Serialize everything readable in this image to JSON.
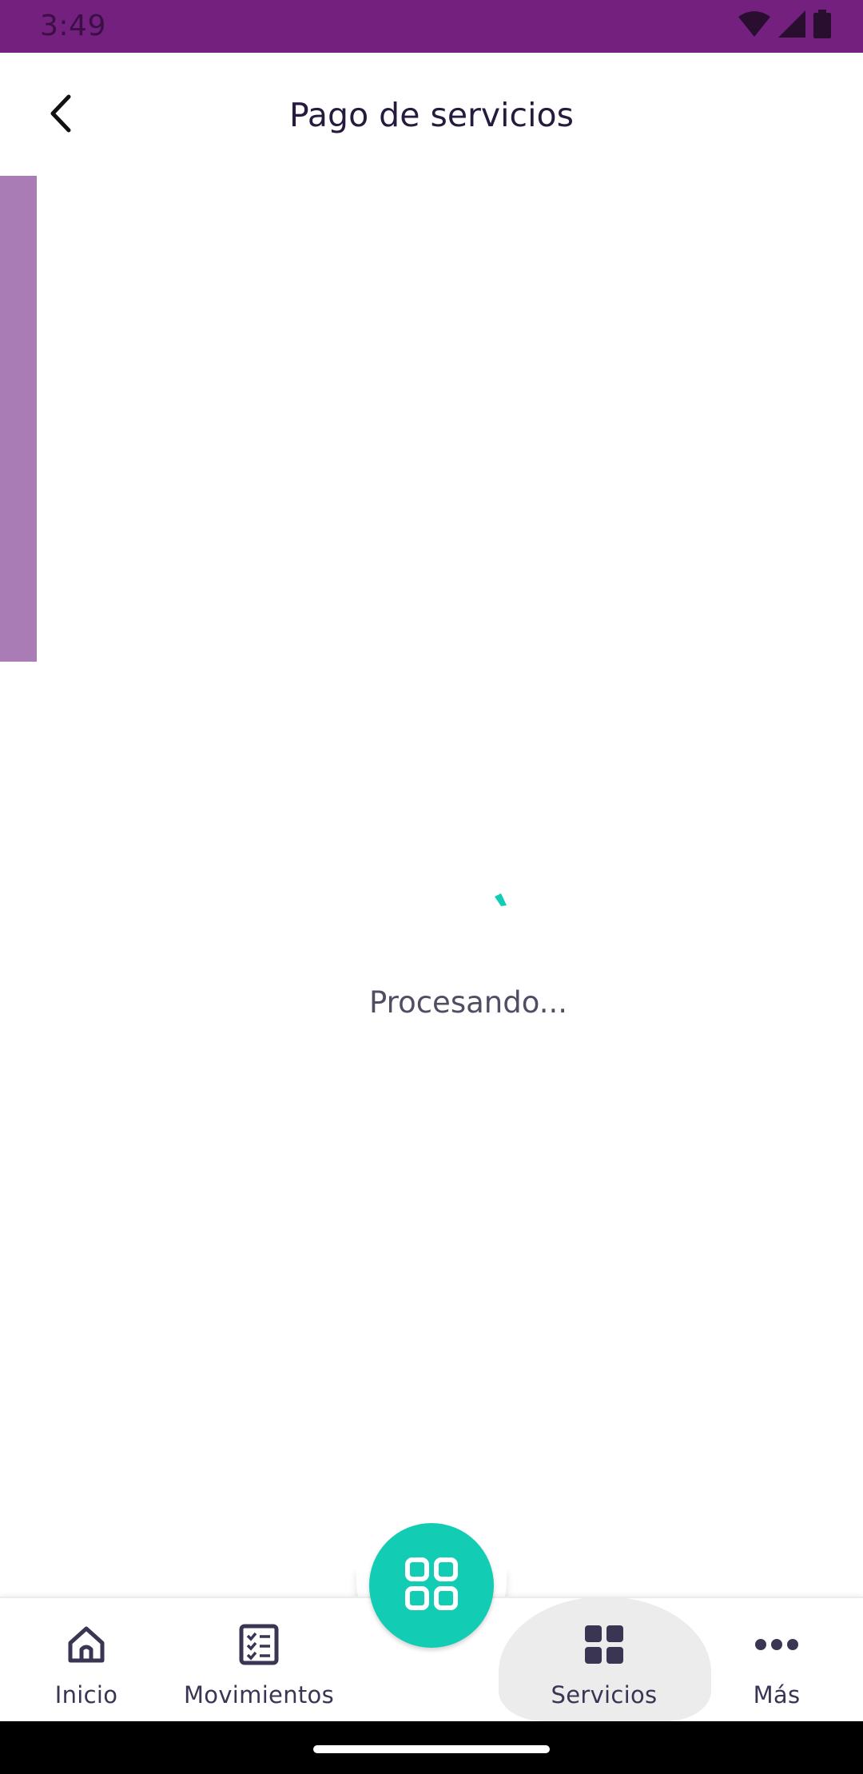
{
  "status_bar": {
    "time": "3:49",
    "icons": [
      "wifi-icon",
      "cell-signal-icon",
      "battery-icon"
    ],
    "background": "#74207f"
  },
  "header": {
    "title": "Pago de servicios",
    "back_icon": "chevron-left-icon"
  },
  "content": {
    "processing_text": "Procesando...",
    "spinner_color": "#12ccb4",
    "side_strip_color": "#a97cb6"
  },
  "bottom_nav": {
    "items": [
      {
        "label": "Inicio",
        "icon": "home-icon"
      },
      {
        "label": "Movimientos",
        "icon": "checklist-icon"
      },
      {
        "label": "Servicios",
        "icon": "grid-icon",
        "active": true
      },
      {
        "label": "Más",
        "icon": "more-horizontal-icon"
      }
    ],
    "fab_icon": "qr-scan-icon",
    "fab_color": "#12ccb4"
  }
}
